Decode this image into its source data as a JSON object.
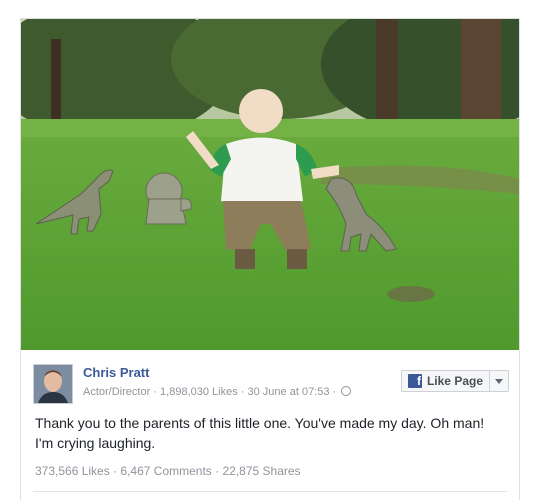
{
  "post": {
    "page_name": "Chris Pratt",
    "category": "Actor/Director",
    "likes": "1,898,030 Likes",
    "date": "30 June at 07:53",
    "separator": "·",
    "like_page_label": "Like Page",
    "message": "Thank you to the parents of this little one. You've made my day. Oh man! I'm crying laughing.",
    "stats": {
      "likes": "373,566 Likes",
      "comments": "6,467 Comments",
      "shares": "22,875 Shares"
    },
    "photo_subject": "toddler-with-toy-dinosaurs-on-grass",
    "icons": {
      "like_button": "facebook-f-icon",
      "privacy": "globe-icon",
      "dropdown": "caret-down-icon"
    }
  },
  "colors": {
    "link": "#3b5998",
    "meta": "#90949c",
    "text": "#1d2129",
    "grass": "#5fa33a"
  }
}
